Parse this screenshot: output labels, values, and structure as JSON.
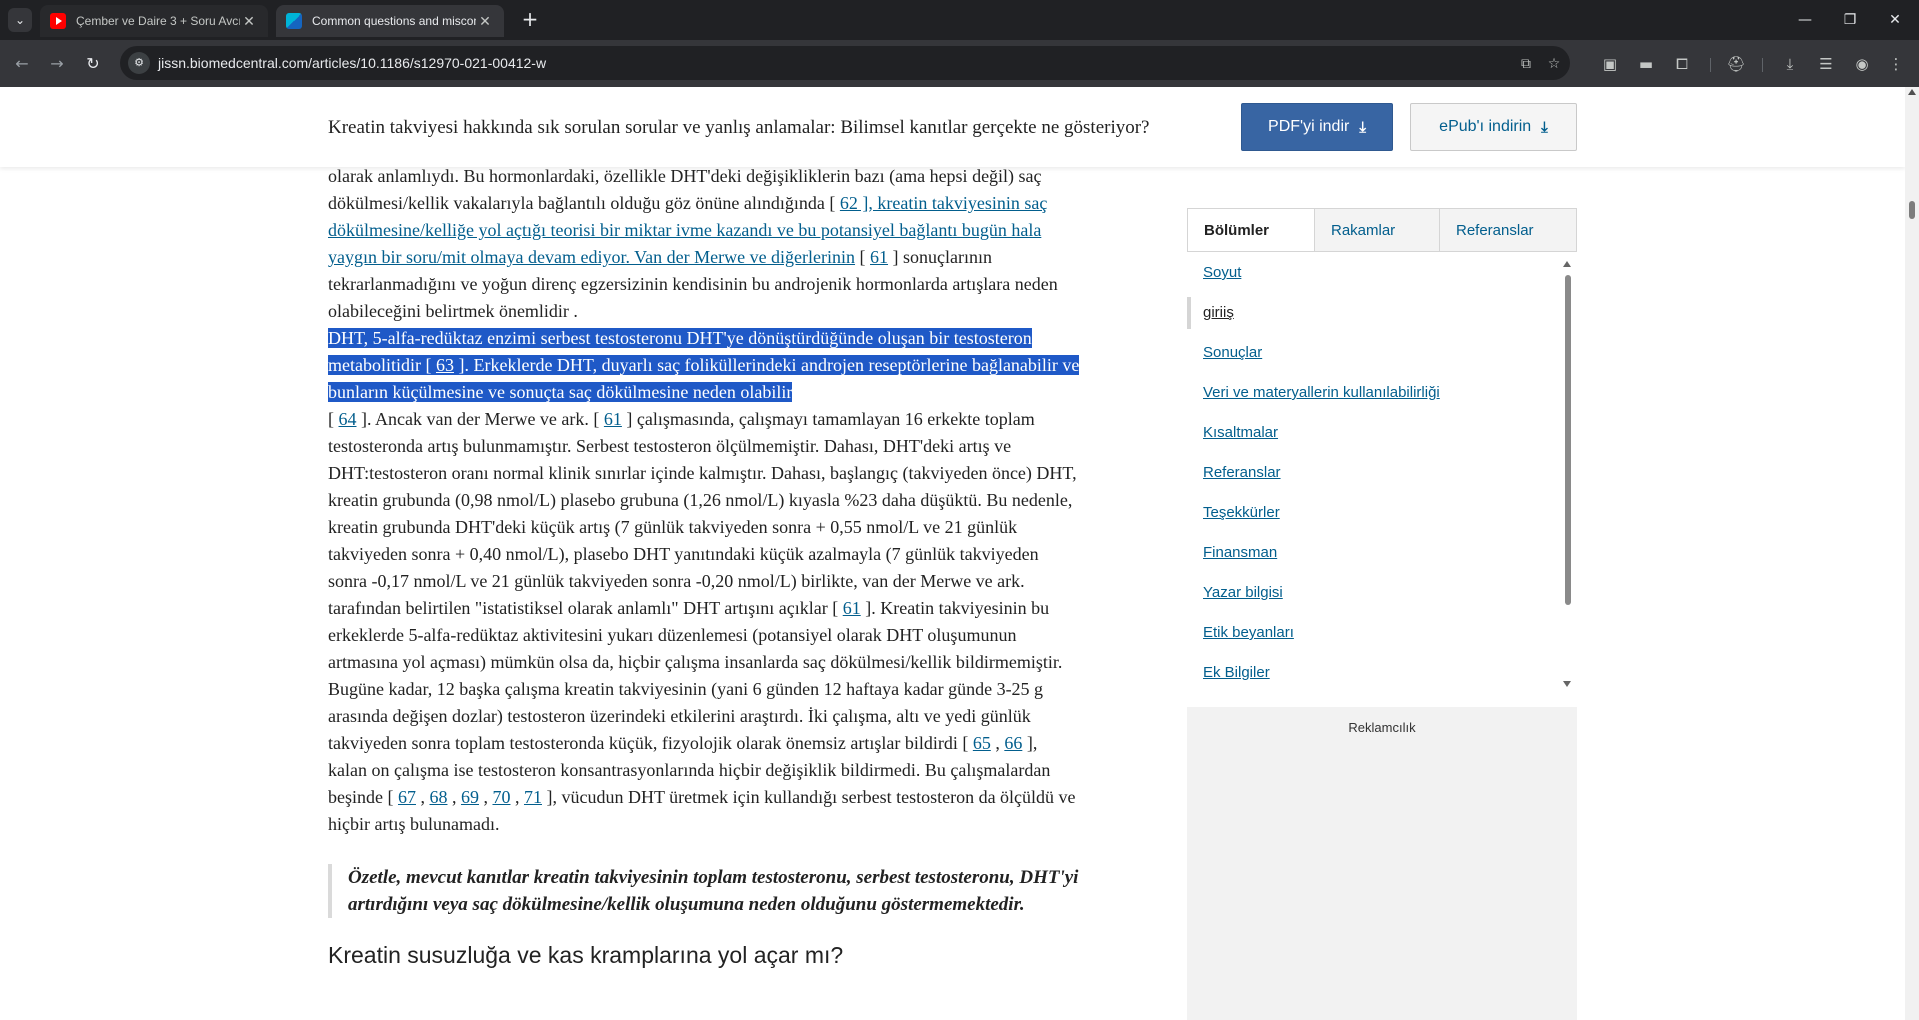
{
  "browser": {
    "tabs": [
      {
        "title": "Çember ve Daire 3 + Soru Avcı",
        "favicon": "youtube-icon",
        "active": false
      },
      {
        "title": "Common questions and miscon",
        "favicon": "biomedcentral-icon",
        "active": true
      }
    ],
    "url": "jissn.biomedcentral.com/articles/10.1186/s12970-021-00412-w"
  },
  "sticky": {
    "title": "Kreatin takviyesi hakkında sık sorulan sorular ve yanlış anlamalar: Bilimsel kanıtlar gerçekte ne gösteriyor?",
    "pdf_label": "PDF'yi indir",
    "epub_label": "ePub'ı indirin"
  },
  "article": {
    "p1_a": "olarak anlamlıydı. Bu hormonlardaki, özellikle DHT'deki değişikliklerin bazı (ama hepsi değil) saç dökülmesi/kellik vakalarıyla bağlantılı olduğu göz önüne alındığında [ ",
    "p1_link_62": "62 ], kreatin takviyesinin saç dökülmesine/kelliğe yol açtığı teorisi bir miktar ivme kazandı ve bu potansiyel bağlantı bugün hala yaygın bir soru/mit olmaya devam ediyor. Van der Merwe ve diğerlerinin",
    "p1_b": " [ ",
    "p1_link_61a": "61",
    "p1_c": " ] sonuçlarının tekrarlanmadığını ve yoğun direnç egzersizinin kendisinin bu androjenik hormonlarda artışlara neden olabileceğini belirtmek önemlidir .",
    "sel_a": "DHT, 5-alfa-redüktaz enzimi serbest testosteronu DHT'ye dönüştürdüğünde oluşan bir testosteron metabolitidir [ ",
    "sel_link_63": "63",
    "sel_b": " ]. Erkeklerde DHT, duyarlı saç foliküllerindeki androjen reseptörlerine bağlanabilir ve bunların küçülmesine ve sonuçta saç dökülmesine neden olabilir",
    "p2_a": " [ ",
    "p2_link_64": "64",
    "p2_b": " ]. Ancak van der Merwe ve ark. [ ",
    "p2_link_61b": "61",
    "p2_c": " ] çalışmasında, çalışmayı tamamlayan 16 erkekte toplam testosteronda artış bulunmamıştır. Serbest testosteron ölçülmemiştir. Dahası, DHT'deki artış ve DHT:testosteron oranı normal klinik sınırlar içinde kalmıştır. Dahası, başlangıç (takviyeden önce) DHT, kreatin grubunda (0,98 nmol/L) plasebo grubuna (1,26 nmol/L) kıyasla %23 daha düşüktü. Bu nedenle, kreatin grubunda DHT'deki küçük artış (7 günlük takviyeden sonra + 0,55 nmol/L ve 21 günlük takviyeden sonra + 0,40 nmol/L), plasebo DHT yanıtındaki küçük azalmayla (7 günlük takviyeden sonra -0,17 nmol/L ve 21 günlük takviyeden sonra -0,20 nmol/L) birlikte, van der Merwe ve ark. tarafından belirtilen \"istatistiksel olarak anlamlı\" DHT artışını açıklar [ ",
    "p2_link_61c": "61",
    "p2_d": " ]. Kreatin takviyesinin bu erkeklerde 5-alfa-redüktaz aktivitesini yukarı düzenlemesi (potansiyel olarak DHT oluşumunun artmasına yol açması) mümkün olsa da, hiçbir çalışma insanlarda saç dökülmesi/kellik bildirmemiştir. Bugüne kadar, 12 başka çalışma kreatin takviyesinin (yani 6 günden 12 haftaya kadar günde 3-25 g arasında değişen dozlar) testosteron üzerindeki etkilerini araştırdı. İki çalışma, altı ve yedi günlük takviyeden sonra toplam testosteronda küçük, fizyolojik olarak önemsiz artışlar bildirdi [ ",
    "p2_link_65": "65",
    "p2_comma1": " , ",
    "p2_link_66": "66",
    "p2_e": " ], kalan on çalışma ise testosteron konsantrasyonlarında hiçbir değişiklik bildirmedi. Bu çalışmalardan beşinde [ ",
    "p2_link_67": "67",
    "p2_comma2": " , ",
    "p2_link_68": "68",
    "p2_comma3": " , ",
    "p2_link_69": "69",
    "p2_comma4": " , ",
    "p2_link_70": "70",
    "p2_comma5": " , ",
    "p2_link_71": "71",
    "p2_f": " ], vücudun DHT üretmek için kullandığı serbest testosteron da ölçüldü ve hiçbir artış bulunamadı.",
    "quote": "Özetle, mevcut kanıtlar kreatin takviyesinin toplam testosteronu, serbest testosteronu, DHT'yi artırdığını veya saç dökülmesine/kellik oluşumuna neden olduğunu göstermemektedir.",
    "next_heading": "Kreatin susuzluğa ve kas kramplarına yol açar mı?"
  },
  "sidebar": {
    "tabs": [
      "Bölümler",
      "Rakamlar",
      "Referanslar"
    ],
    "items": [
      "Soyut",
      "giriiş",
      "Sonuçlar",
      "Veri ve materyallerin kullanılabilirliği",
      "Kısaltmalar",
      "Referanslar",
      "Teşekkürler",
      "Finansman",
      "Yazar bilgisi",
      "Etik beyanları",
      "Ek Bilgiler"
    ],
    "current_item": "giriiş",
    "ad_label": "Reklamcılık"
  }
}
